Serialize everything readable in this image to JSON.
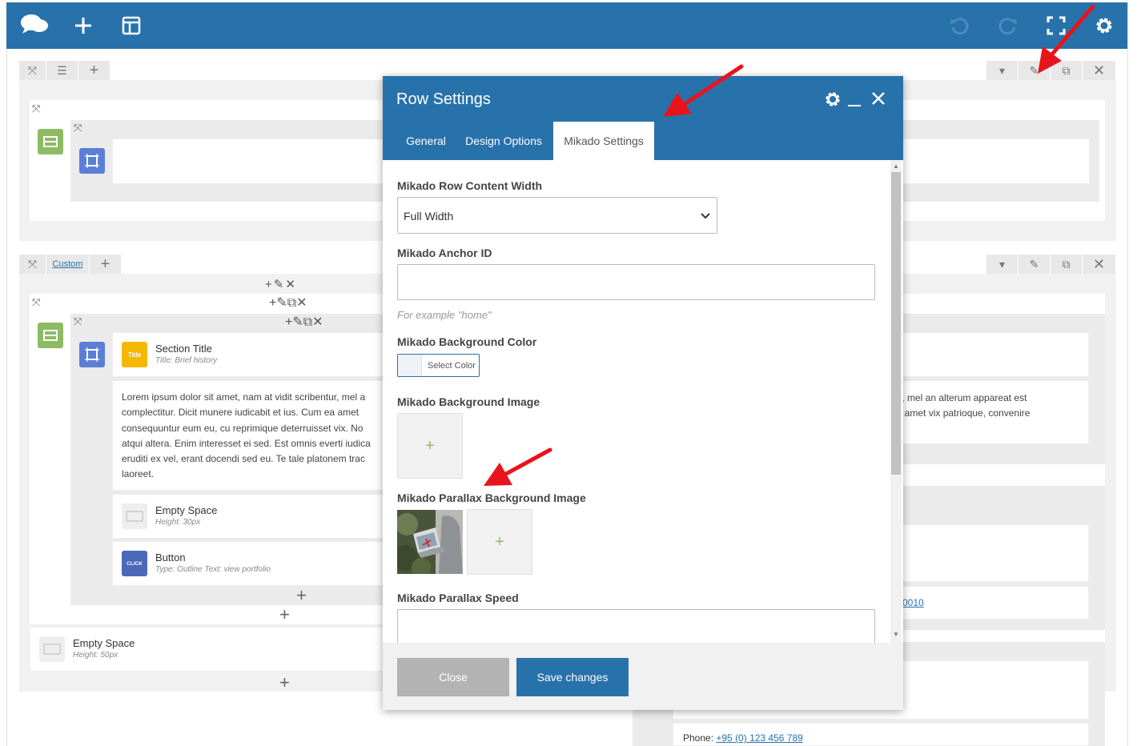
{
  "toolbar": {
    "logo_icon": "cloud-logo-icon",
    "add_icon": "plus-icon",
    "templates_icon": "layout-icon",
    "undo_icon": "undo-icon",
    "redo_icon": "redo-icon",
    "fullscreen_icon": "fullscreen-icon",
    "settings_icon": "gear-icon"
  },
  "row2": {
    "custom_label": "Custom"
  },
  "elements": {
    "section_title": {
      "name": "Section Title",
      "sub": "Title: Brief history",
      "icon_text": "Title"
    },
    "paragraph_lines": [
      "Lorem ipsum dolor sit amet, nam at vidit scribentur, mel a",
      "complectitur. Dicit munere iudicabit et ius. Cum ea amet",
      "consequuntur eum eu, cu reprimique deterruisset vix. No",
      "atqui altera. Enim interesset ei sed. Est omnis everti iudica",
      "eruditi ex vel, erant docendi sed eu. Te tale platonem trac",
      "laoreet."
    ],
    "empty_space_1": {
      "name": "Empty Space",
      "sub": "Height: 30px"
    },
    "button": {
      "name": "Button",
      "sub": "Type: Outline  Text: view portfolio",
      "icon_text": "CLICK"
    },
    "empty_space_2": {
      "name": "Empty Space",
      "sub": "Height: 50px"
    }
  },
  "right_column": {
    "text_line1": "tur, mel an alterum appareat est",
    "text_line2": "ea amet vix patrioque, convenire",
    "link_fragment": "0010",
    "phone_label": "Phone: ",
    "phone_value": "+95 (0) 123 456 789"
  },
  "modal": {
    "title": "Row Settings",
    "tabs": [
      "General",
      "Design Options",
      "Mikado Settings"
    ],
    "active_tab": "Mikado Settings",
    "fields": {
      "content_width_label": "Mikado Row Content Width",
      "content_width_value": "Full Width",
      "anchor_label": "Mikado Anchor ID",
      "anchor_value": "",
      "anchor_hint": "For example \"home\"",
      "bg_color_label": "Mikado Background Color",
      "bg_color_button": "Select Color",
      "bg_image_label": "Mikado Background Image",
      "parallax_image_label": "Mikado Parallax Background Image",
      "parallax_speed_label": "Mikado Parallax Speed",
      "parallax_speed_value": ""
    },
    "close_label": "Close",
    "save_label": "Save changes"
  },
  "colors": {
    "brand_blue": "#2872ab",
    "green": "#8dbb64",
    "element_blue": "#5b7ed6",
    "title_yellow": "#f5b800",
    "arrow_red": "#e8141b"
  }
}
